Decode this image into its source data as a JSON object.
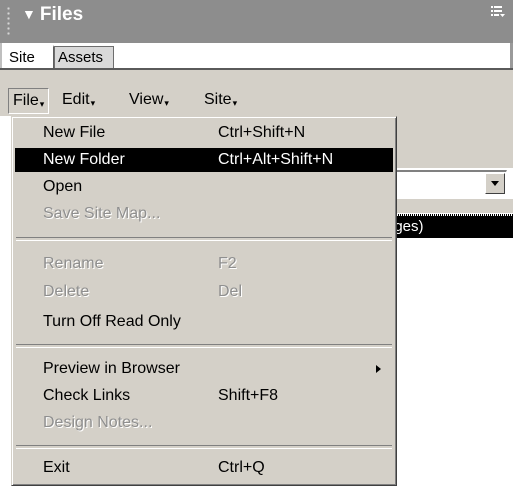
{
  "panel": {
    "title": "Files",
    "title_arrow": "▼",
    "tabs": [
      {
        "label": "Site",
        "active": true
      },
      {
        "label": "Assets",
        "active": false
      }
    ]
  },
  "menubar": {
    "items": [
      {
        "label": "File",
        "open": true
      },
      {
        "label": "Edit"
      },
      {
        "label": "View"
      },
      {
        "label": "Site"
      }
    ],
    "arrow_glyph": "▾"
  },
  "background": {
    "selected_row_text": "ages)"
  },
  "file_menu": {
    "groups": [
      [
        {
          "label": "New File",
          "shortcut": "Ctrl+Shift+N",
          "enabled": true,
          "highlighted": false
        },
        {
          "label": "New Folder",
          "shortcut": "Ctrl+Alt+Shift+N",
          "enabled": true,
          "highlighted": true
        },
        {
          "label": "Open",
          "shortcut": "",
          "enabled": true,
          "highlighted": false
        },
        {
          "label": "Save Site Map...",
          "shortcut": "",
          "enabled": false,
          "highlighted": false
        }
      ],
      [
        {
          "label": "Rename",
          "shortcut": "F2",
          "enabled": false,
          "highlighted": false
        },
        {
          "label": "Delete",
          "shortcut": "Del",
          "enabled": false,
          "highlighted": false
        },
        {
          "label": "Turn Off Read Only",
          "shortcut": "",
          "enabled": true,
          "highlighted": false
        }
      ],
      [
        {
          "label": "Preview in Browser",
          "shortcut": "",
          "enabled": true,
          "highlighted": false,
          "submenu": true
        },
        {
          "label": "Check Links",
          "shortcut": "Shift+F8",
          "enabled": true,
          "highlighted": false
        },
        {
          "label": "Design Notes...",
          "shortcut": "",
          "enabled": false,
          "highlighted": false
        }
      ],
      [
        {
          "label": "Exit",
          "shortcut": "Ctrl+Q",
          "enabled": true,
          "highlighted": false
        }
      ]
    ]
  },
  "icons": {
    "panel_gripper": "gripper-icon",
    "panel_options": "options-menu-icon",
    "combo_dropdown": "dropdown-arrow-icon",
    "submenu_arrow": "submenu-arrow-icon"
  }
}
